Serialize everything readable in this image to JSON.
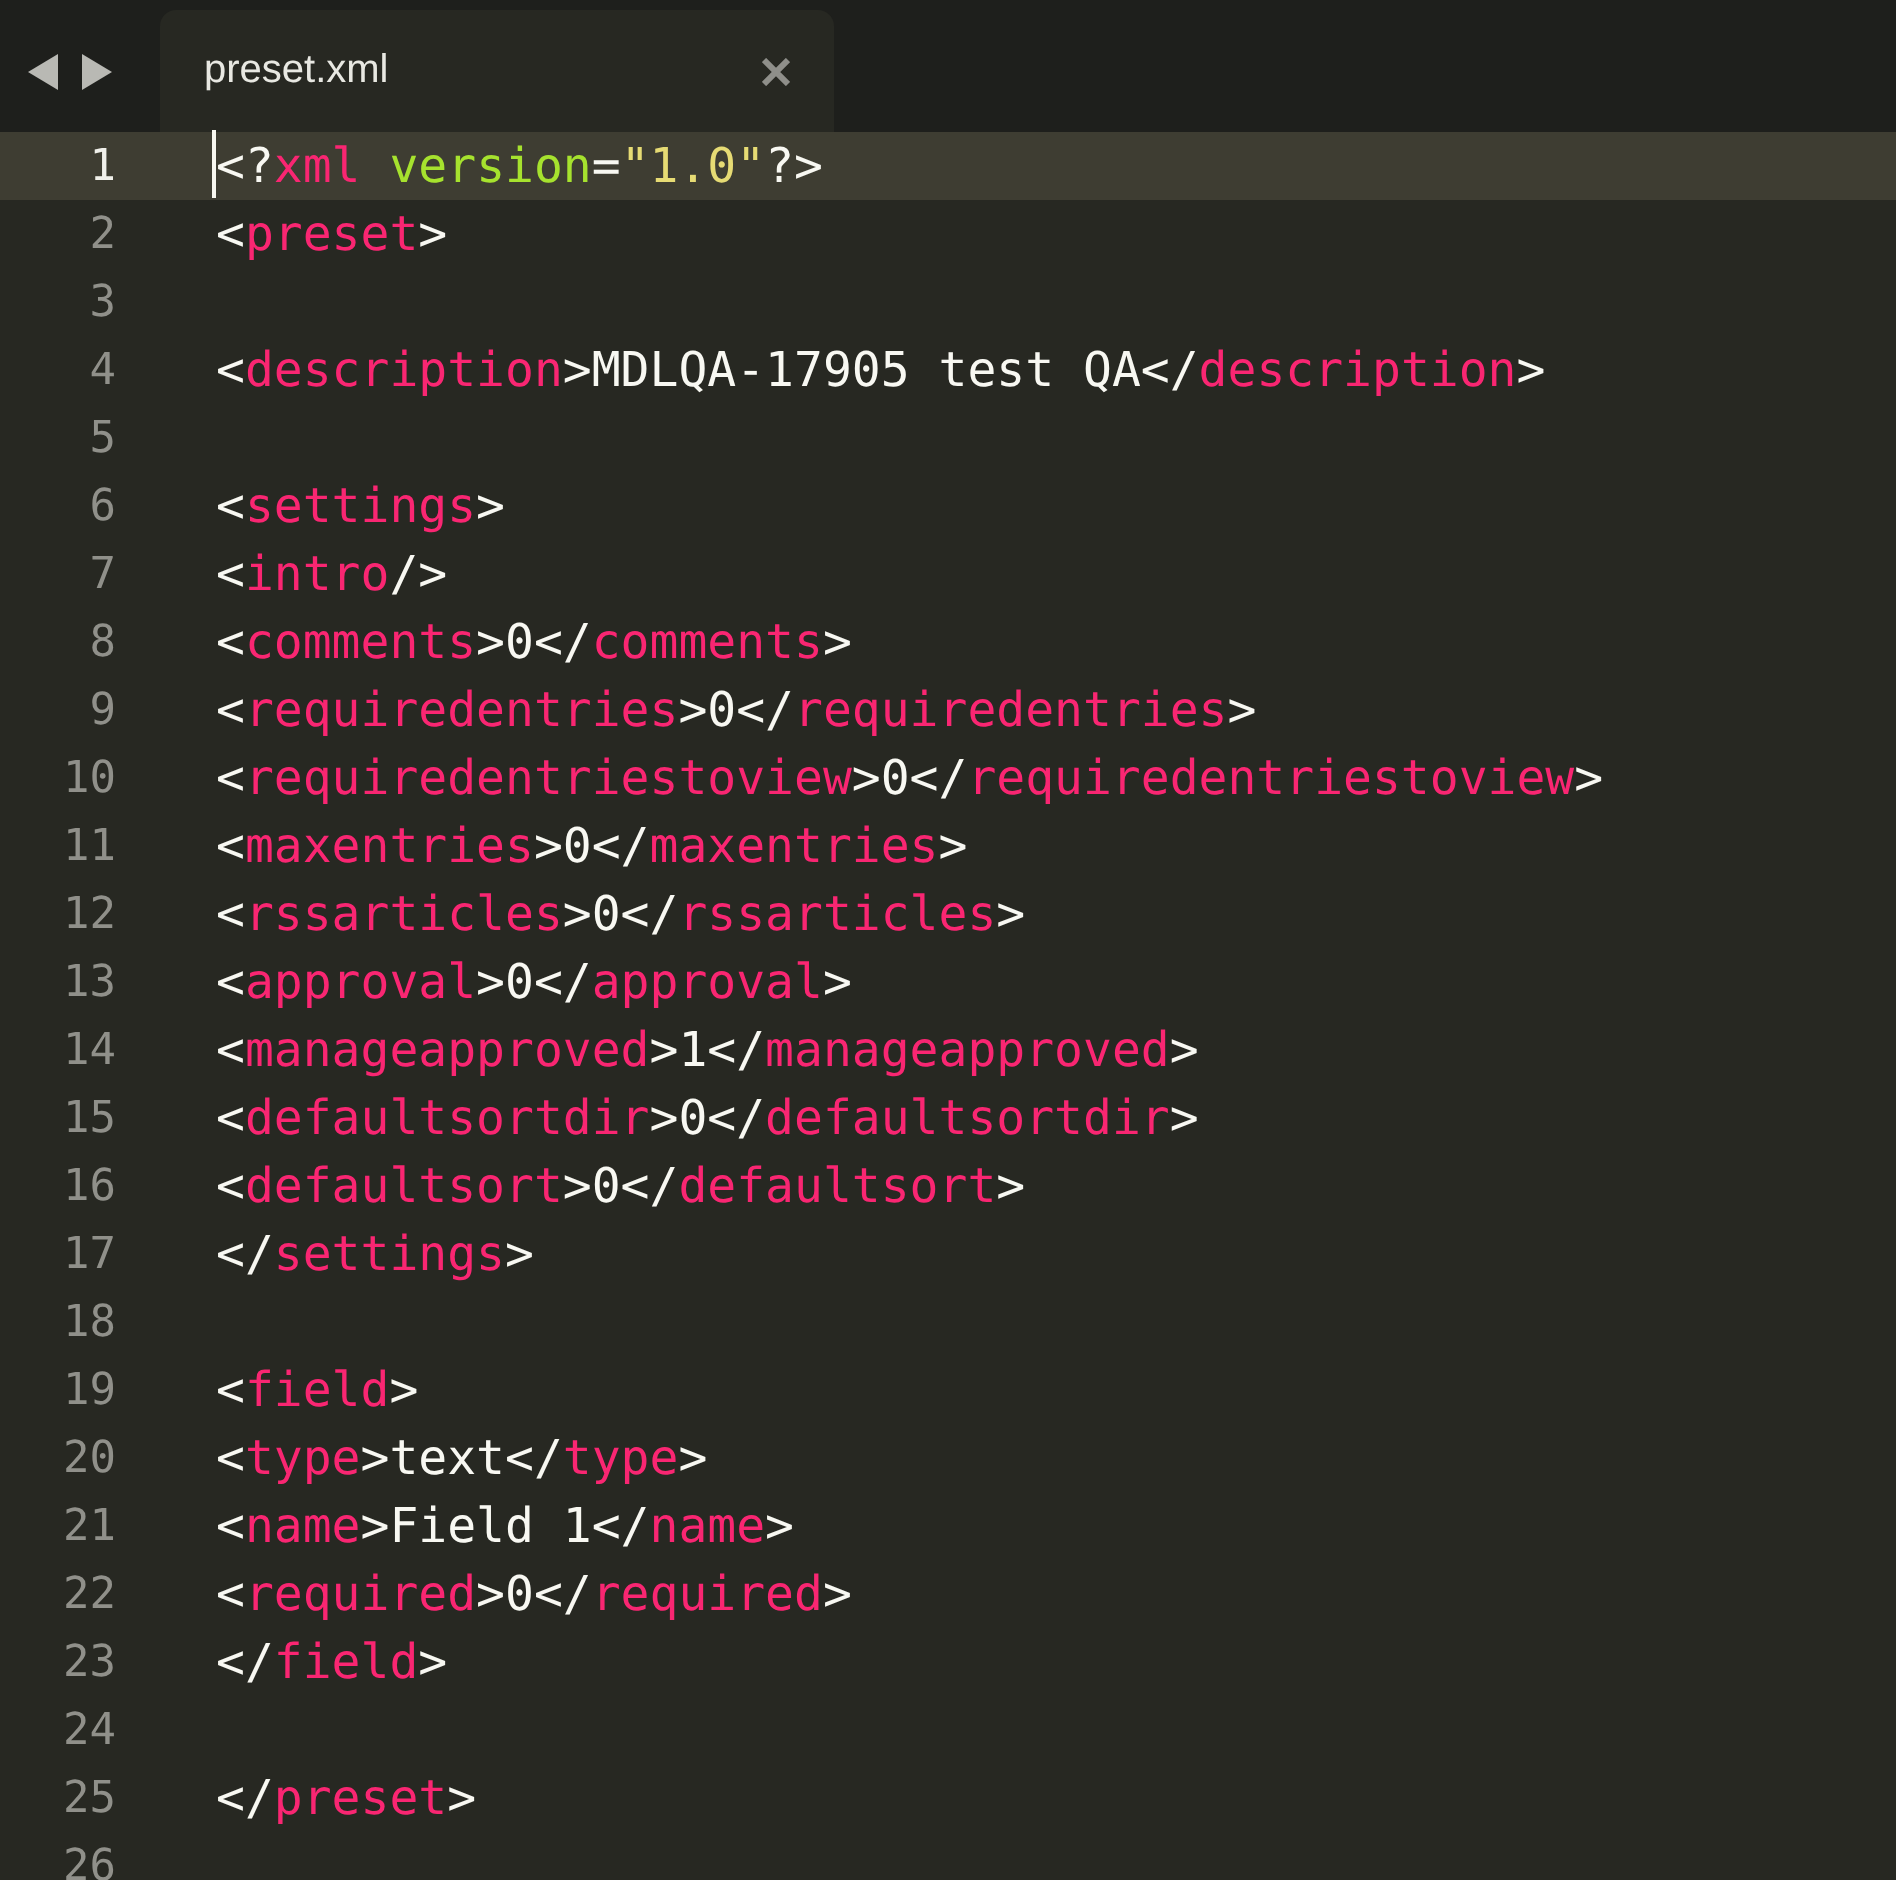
{
  "tabs": [
    {
      "label": "preset.xml",
      "selected": true
    }
  ],
  "lines": [
    {
      "number": "1",
      "current": true,
      "tokens": [
        {
          "kind": "punct",
          "text": "<?"
        },
        {
          "kind": "tag",
          "text": "xml"
        },
        {
          "kind": "attr",
          "text": " version"
        },
        {
          "kind": "punct",
          "text": "="
        },
        {
          "kind": "string",
          "text": "\"1.0\""
        },
        {
          "kind": "punct",
          "text": "?>"
        }
      ]
    },
    {
      "number": "2",
      "current": false,
      "tokens": [
        {
          "kind": "punct",
          "text": "<"
        },
        {
          "kind": "tag",
          "text": "preset"
        },
        {
          "kind": "punct",
          "text": ">"
        }
      ]
    },
    {
      "number": "3",
      "current": false
    },
    {
      "number": "4",
      "current": false,
      "tokens": [
        {
          "kind": "punct",
          "text": "<"
        },
        {
          "kind": "tag",
          "text": "description"
        },
        {
          "kind": "punct",
          "text": ">MDLQA-17905 test QA</"
        },
        {
          "kind": "tag",
          "text": "description"
        },
        {
          "kind": "punct",
          "text": ">"
        }
      ]
    },
    {
      "number": "5",
      "current": false
    },
    {
      "number": "6",
      "current": false,
      "tokens": [
        {
          "kind": "punct",
          "text": "<"
        },
        {
          "kind": "tag",
          "text": "settings"
        },
        {
          "kind": "punct",
          "text": ">"
        }
      ]
    },
    {
      "number": "7",
      "current": false,
      "tokens": [
        {
          "kind": "punct",
          "text": "<"
        },
        {
          "kind": "tag",
          "text": "intro"
        },
        {
          "kind": "punct",
          "text": "/>"
        }
      ]
    },
    {
      "number": "8",
      "current": false,
      "tokens": [
        {
          "kind": "punct",
          "text": "<"
        },
        {
          "kind": "tag",
          "text": "comments"
        },
        {
          "kind": "punct",
          "text": ">0</"
        },
        {
          "kind": "tag",
          "text": "comments"
        },
        {
          "kind": "punct",
          "text": ">"
        }
      ]
    },
    {
      "number": "9",
      "current": false,
      "tokens": [
        {
          "kind": "punct",
          "text": "<"
        },
        {
          "kind": "tag",
          "text": "requiredentries"
        },
        {
          "kind": "punct",
          "text": ">0</"
        },
        {
          "kind": "tag",
          "text": "requiredentries"
        },
        {
          "kind": "punct",
          "text": ">"
        }
      ]
    },
    {
      "number": "10",
      "current": false,
      "tokens": [
        {
          "kind": "punct",
          "text": "<"
        },
        {
          "kind": "tag",
          "text": "requiredentriestoview"
        },
        {
          "kind": "punct",
          "text": ">0</"
        },
        {
          "kind": "tag",
          "text": "requiredentriestoview"
        },
        {
          "kind": "punct",
          "text": ">"
        }
      ]
    },
    {
      "number": "11",
      "current": false,
      "tokens": [
        {
          "kind": "punct",
          "text": "<"
        },
        {
          "kind": "tag",
          "text": "maxentries"
        },
        {
          "kind": "punct",
          "text": ">0</"
        },
        {
          "kind": "tag",
          "text": "maxentries"
        },
        {
          "kind": "punct",
          "text": ">"
        }
      ]
    },
    {
      "number": "12",
      "current": false,
      "tokens": [
        {
          "kind": "punct",
          "text": "<"
        },
        {
          "kind": "tag",
          "text": "rssarticles"
        },
        {
          "kind": "punct",
          "text": ">0</"
        },
        {
          "kind": "tag",
          "text": "rssarticles"
        },
        {
          "kind": "punct",
          "text": ">"
        }
      ]
    },
    {
      "number": "13",
      "current": false,
      "tokens": [
        {
          "kind": "punct",
          "text": "<"
        },
        {
          "kind": "tag",
          "text": "approval"
        },
        {
          "kind": "punct",
          "text": ">0</"
        },
        {
          "kind": "tag",
          "text": "approval"
        },
        {
          "kind": "punct",
          "text": ">"
        }
      ]
    },
    {
      "number": "14",
      "current": false,
      "tokens": [
        {
          "kind": "punct",
          "text": "<"
        },
        {
          "kind": "tag",
          "text": "manageapproved"
        },
        {
          "kind": "punct",
          "text": ">1</"
        },
        {
          "kind": "tag",
          "text": "manageapproved"
        },
        {
          "kind": "punct",
          "text": ">"
        }
      ]
    },
    {
      "number": "15",
      "current": false,
      "tokens": [
        {
          "kind": "punct",
          "text": "<"
        },
        {
          "kind": "tag",
          "text": "defaultsortdir"
        },
        {
          "kind": "punct",
          "text": ">0</"
        },
        {
          "kind": "tag",
          "text": "defaultsortdir"
        },
        {
          "kind": "punct",
          "text": ">"
        }
      ]
    },
    {
      "number": "16",
      "current": false,
      "tokens": [
        {
          "kind": "punct",
          "text": "<"
        },
        {
          "kind": "tag",
          "text": "defaultsort"
        },
        {
          "kind": "punct",
          "text": ">0</"
        },
        {
          "kind": "tag",
          "text": "defaultsort"
        },
        {
          "kind": "punct",
          "text": ">"
        }
      ]
    },
    {
      "number": "17",
      "current": false,
      "tokens": [
        {
          "kind": "punct",
          "text": "</"
        },
        {
          "kind": "tag",
          "text": "settings"
        },
        {
          "kind": "punct",
          "text": ">"
        }
      ]
    },
    {
      "number": "18",
      "current": false
    },
    {
      "number": "19",
      "current": false,
      "tokens": [
        {
          "kind": "punct",
          "text": "<"
        },
        {
          "kind": "tag",
          "text": "field"
        },
        {
          "kind": "punct",
          "text": ">"
        }
      ]
    },
    {
      "number": "20",
      "current": false,
      "tokens": [
        {
          "kind": "punct",
          "text": "<"
        },
        {
          "kind": "tag",
          "text": "type"
        },
        {
          "kind": "punct",
          "text": ">text</"
        },
        {
          "kind": "tag",
          "text": "type"
        },
        {
          "kind": "punct",
          "text": ">"
        }
      ]
    },
    {
      "number": "21",
      "current": false,
      "tokens": [
        {
          "kind": "punct",
          "text": "<"
        },
        {
          "kind": "tag",
          "text": "name"
        },
        {
          "kind": "punct",
          "text": ">Field 1</"
        },
        {
          "kind": "tag",
          "text": "name"
        },
        {
          "kind": "punct",
          "text": ">"
        }
      ]
    },
    {
      "number": "22",
      "current": false,
      "tokens": [
        {
          "kind": "punct",
          "text": "<"
        },
        {
          "kind": "tag",
          "text": "required"
        },
        {
          "kind": "punct",
          "text": ">0</"
        },
        {
          "kind": "tag",
          "text": "required"
        },
        {
          "kind": "punct",
          "text": ">"
        }
      ]
    },
    {
      "number": "23",
      "current": false,
      "tokens": [
        {
          "kind": "punct",
          "text": "</"
        },
        {
          "kind": "tag",
          "text": "field"
        },
        {
          "kind": "punct",
          "text": ">"
        }
      ]
    },
    {
      "number": "24",
      "current": false
    },
    {
      "number": "25",
      "current": false,
      "tokens": [
        {
          "kind": "punct",
          "text": "</"
        },
        {
          "kind": "tag",
          "text": "preset"
        },
        {
          "kind": "punct",
          "text": ">"
        }
      ]
    },
    {
      "number": "26",
      "current": false
    }
  ]
}
